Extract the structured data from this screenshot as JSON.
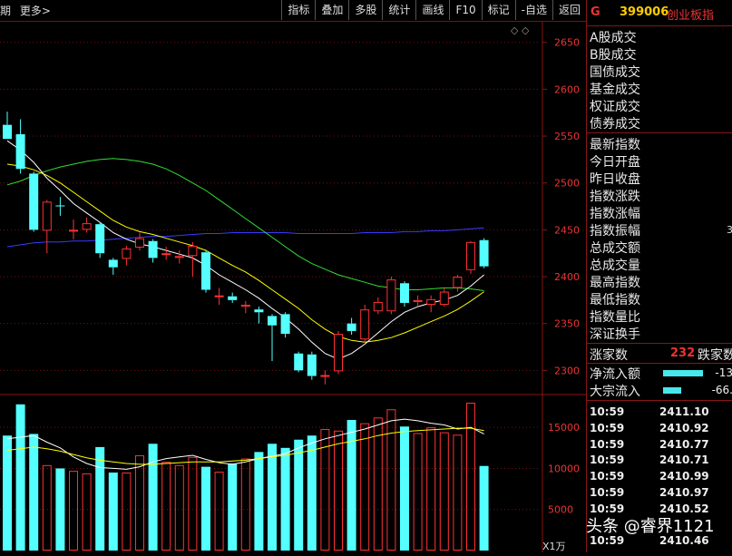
{
  "toolbar": {
    "left_items": [
      "期",
      "更多>"
    ],
    "buttons": [
      "指标",
      "叠加",
      "多股",
      "统计",
      "画线",
      "F10",
      "标记",
      "-自选",
      "返回"
    ]
  },
  "chart": {
    "corner_icon": "◇ ◇",
    "price_axis": [
      "2650",
      "2600",
      "2550",
      "2500",
      "2450",
      "2400",
      "2350",
      "2300"
    ],
    "volume_axis": [
      "15000",
      "10000",
      "5000"
    ],
    "volume_unit": "X1万"
  },
  "quote": {
    "market_flag": "G",
    "code": "399006",
    "name": "创业板指",
    "turnover_labels": [
      "A股成交",
      "B股成交",
      "国债成交",
      "基金成交",
      "权证成交",
      "债券成交"
    ],
    "index_labels": [
      "最新指数",
      "今日开盘",
      "昨日收盘",
      "指数涨跌",
      "指数涨幅",
      "指数振幅",
      "总成交额",
      "总成交量",
      "最高指数",
      "最低指数",
      "指数量比",
      "深证换手"
    ],
    "amplitude_partial": "3",
    "rise_label": "涨家数",
    "rise_count": "232",
    "fall_label": "跌家数",
    "net_inflow_label": "净流入额",
    "net_inflow_value": "-13",
    "block_inflow_label": "大宗流入",
    "block_inflow_value": "-66.",
    "ticks": [
      {
        "time": "10:59",
        "price": "2411.10"
      },
      {
        "time": "10:59",
        "price": "2410.92"
      },
      {
        "time": "10:59",
        "price": "2410.77"
      },
      {
        "time": "10:59",
        "price": "2410.71"
      },
      {
        "time": "10:59",
        "price": "2410.99"
      },
      {
        "time": "10:59",
        "price": "2410.97"
      },
      {
        "time": "10:59",
        "price": "2410.52"
      },
      {
        "time": "10:59",
        "price": "2410.46"
      }
    ]
  },
  "watermark": "头条 @睿界1121",
  "chart_data": {
    "type": "candlestick",
    "price_ylim": [
      2280,
      2672
    ],
    "volume_ylim": [
      0,
      18000
    ],
    "candles": [
      {
        "o": 2562,
        "c": 2547,
        "h": 2576,
        "l": 2550,
        "v": 14000
      },
      {
        "o": 2552,
        "c": 2515,
        "h": 2568,
        "l": 2510,
        "v": 17800
      },
      {
        "o": 2510,
        "c": 2450,
        "h": 2512,
        "l": 2448,
        "v": 14200
      },
      {
        "o": 2449,
        "c": 2480,
        "h": 2482,
        "l": 2425,
        "v": 10400
      },
      {
        "o": 2476,
        "c": 2475,
        "h": 2485,
        "l": 2465,
        "v": 10000
      },
      {
        "o": 2450,
        "c": 2450,
        "h": 2461,
        "l": 2440,
        "v": 9700
      },
      {
        "o": 2450,
        "c": 2457,
        "h": 2463,
        "l": 2447,
        "v": 9400
      },
      {
        "o": 2456,
        "c": 2425,
        "h": 2458,
        "l": 2420,
        "v": 12600
      },
      {
        "o": 2418,
        "c": 2410,
        "h": 2420,
        "l": 2402,
        "v": 9500
      },
      {
        "o": 2419,
        "c": 2430,
        "h": 2433,
        "l": 2412,
        "v": 9500
      },
      {
        "o": 2431,
        "c": 2441,
        "h": 2447,
        "l": 2428,
        "v": 11600
      },
      {
        "o": 2438,
        "c": 2420,
        "h": 2440,
        "l": 2415,
        "v": 13000
      },
      {
        "o": 2425,
        "c": 2425,
        "h": 2432,
        "l": 2418,
        "v": 10800
      },
      {
        "o": 2420,
        "c": 2422,
        "h": 2428,
        "l": 2414,
        "v": 10400
      },
      {
        "o": 2422,
        "c": 2433,
        "h": 2437,
        "l": 2400,
        "v": 11400
      },
      {
        "o": 2426,
        "c": 2386,
        "h": 2428,
        "l": 2383,
        "v": 10200
      },
      {
        "o": 2380,
        "c": 2380,
        "h": 2388,
        "l": 2370,
        "v": 9600
      },
      {
        "o": 2379,
        "c": 2375,
        "h": 2383,
        "l": 2372,
        "v": 10600
      },
      {
        "o": 2368,
        "c": 2370,
        "h": 2374,
        "l": 2361,
        "v": 11200
      },
      {
        "o": 2365,
        "c": 2362,
        "h": 2368,
        "l": 2350,
        "v": 12000
      },
      {
        "o": 2358,
        "c": 2348,
        "h": 2360,
        "l": 2310,
        "v": 13000
      },
      {
        "o": 2360,
        "c": 2339,
        "h": 2362,
        "l": 2335,
        "v": 12500
      },
      {
        "o": 2318,
        "c": 2300,
        "h": 2320,
        "l": 2298,
        "v": 13500
      },
      {
        "o": 2317,
        "c": 2294,
        "h": 2320,
        "l": 2290,
        "v": 14000
      },
      {
        "o": 2295,
        "c": 2295,
        "h": 2300,
        "l": 2285,
        "v": 14800
      },
      {
        "o": 2299,
        "c": 2339,
        "h": 2342,
        "l": 2296,
        "v": 14600
      },
      {
        "o": 2350,
        "c": 2342,
        "h": 2356,
        "l": 2338,
        "v": 15900
      },
      {
        "o": 2333,
        "c": 2365,
        "h": 2370,
        "l": 2330,
        "v": 15500
      },
      {
        "o": 2363,
        "c": 2373,
        "h": 2378,
        "l": 2360,
        "v": 16200
      },
      {
        "o": 2363,
        "c": 2397,
        "h": 2400,
        "l": 2360,
        "v": 17200
      },
      {
        "o": 2393,
        "c": 2372,
        "h": 2395,
        "l": 2368,
        "v": 15100
      },
      {
        "o": 2373,
        "c": 2375,
        "h": 2380,
        "l": 2368,
        "v": 14300
      },
      {
        "o": 2370,
        "c": 2376,
        "h": 2380,
        "l": 2362,
        "v": 15000
      },
      {
        "o": 2370,
        "c": 2384,
        "h": 2388,
        "l": 2368,
        "v": 14400
      },
      {
        "o": 2388,
        "c": 2400,
        "h": 2402,
        "l": 2384,
        "v": 14100
      },
      {
        "o": 2407,
        "c": 2437,
        "h": 2438,
        "l": 2403,
        "v": 18000
      },
      {
        "o": 2439,
        "c": 2411,
        "h": 2441,
        "l": 2409,
        "v": 10300
      }
    ],
    "ma_white": [
      2545,
      2535,
      2522,
      2505,
      2492,
      2478,
      2468,
      2458,
      2447,
      2440,
      2435,
      2432,
      2428,
      2424,
      2420,
      2412,
      2402,
      2394,
      2386,
      2377,
      2366,
      2356,
      2344,
      2330,
      2318,
      2312,
      2318,
      2328,
      2340,
      2352,
      2362,
      2368,
      2372,
      2375,
      2380,
      2390,
      2402
    ],
    "ma_yellow": [
      2520,
      2518,
      2514,
      2508,
      2500,
      2490,
      2480,
      2470,
      2460,
      2453,
      2448,
      2445,
      2441,
      2437,
      2433,
      2428,
      2420,
      2412,
      2405,
      2396,
      2386,
      2376,
      2366,
      2354,
      2344,
      2336,
      2332,
      2330,
      2332,
      2335,
      2340,
      2346,
      2352,
      2358,
      2365,
      2374,
      2384
    ],
    "ma_green": [
      2498,
      2502,
      2508,
      2513,
      2517,
      2520,
      2523,
      2525,
      2526,
      2525,
      2523,
      2520,
      2515,
      2508,
      2500,
      2492,
      2482,
      2472,
      2462,
      2452,
      2442,
      2432,
      2422,
      2414,
      2408,
      2402,
      2398,
      2394,
      2390,
      2388,
      2386,
      2386,
      2387,
      2388,
      2388,
      2387,
      2385
    ],
    "ma_blue": [
      2432,
      2434,
      2436,
      2437,
      2437,
      2438,
      2438,
      2439,
      2440,
      2441,
      2442,
      2443,
      2443,
      2444,
      2445,
      2446,
      2446,
      2447,
      2447,
      2447,
      2447,
      2447,
      2446,
      2446,
      2446,
      2446,
      2446,
      2447,
      2447,
      2447,
      2448,
      2448,
      2449,
      2449,
      2450,
      2451,
      2452
    ],
    "vol_ma_white": [
      13600,
      13800,
      14000,
      13200,
      12500,
      11400,
      10600,
      10100,
      10000,
      9900,
      10200,
      10800,
      11200,
      11400,
      11600,
      11100,
      10700,
      10500,
      10800,
      11200,
      11500,
      11800,
      12500,
      13100,
      13600,
      14000,
      14400,
      14800,
      15300,
      15800,
      16000,
      15800,
      15500,
      15300,
      14800,
      15000,
      14200
    ],
    "vol_ma_yellow": [
      12200,
      12400,
      12600,
      12400,
      12100,
      11700,
      11300,
      11000,
      10800,
      10600,
      10500,
      10500,
      10600,
      10700,
      10800,
      10800,
      10800,
      10900,
      11000,
      11200,
      11400,
      11600,
      11900,
      12200,
      12600,
      13000,
      13300,
      13600,
      14000,
      14300,
      14500,
      14600,
      14700,
      14800,
      14900,
      14900,
      14600
    ]
  }
}
